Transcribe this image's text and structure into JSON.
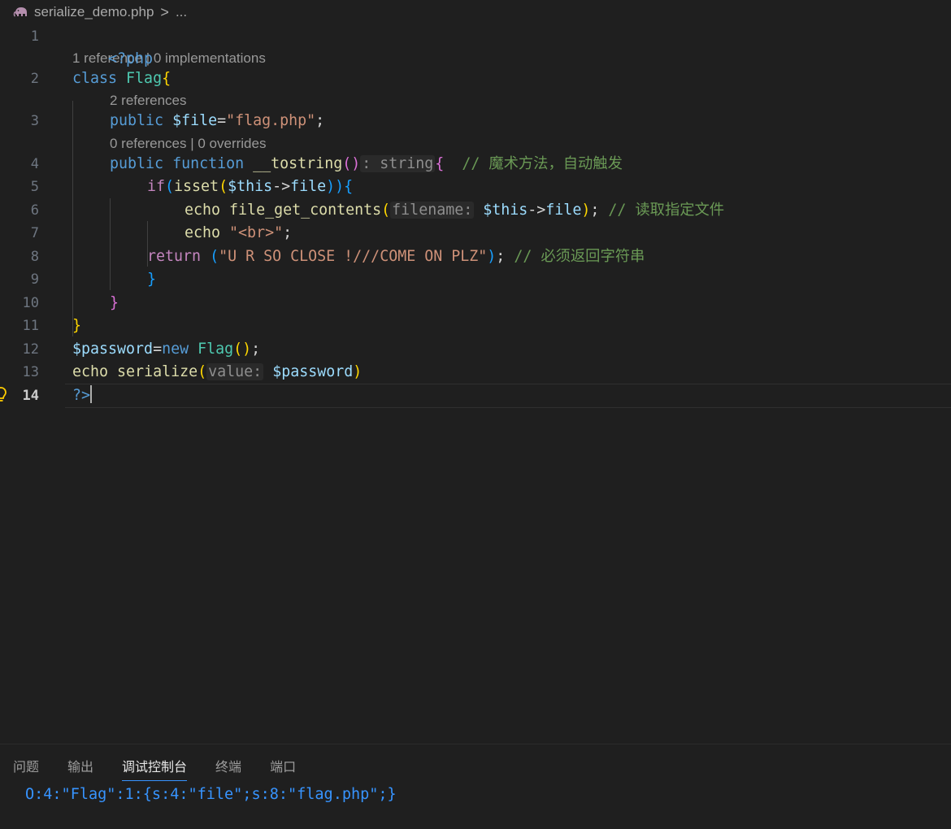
{
  "breadcrumb": {
    "file": "serialize_demo.php",
    "separator": ">",
    "more": "..."
  },
  "editor": {
    "line_numbers": [
      "1",
      "2",
      "3",
      "4",
      "5",
      "6",
      "7",
      "8",
      "9",
      "10",
      "11",
      "12",
      "13",
      "14"
    ],
    "codelens": {
      "l1": "1 reference | 0 implementations",
      "l2": "2 references",
      "l3": "0 references | 0 overrides"
    },
    "code": {
      "l1_open": "<?php",
      "l2_class": "class",
      "l2_name": "Flag",
      "l2_brace": "{",
      "l3_public": "public",
      "l3_var": "$file",
      "l3_eq": "=",
      "l3_str": "\"flag.php\"",
      "l3_semi": ";",
      "l4_public": "public",
      "l4_function": "function",
      "l4_fn": "__tostring",
      "l4_parens": "()",
      "l4_hint": ": string",
      "l4_brace": "{",
      "l4_comment": "// 魔术方法，自动触发",
      "l5_if": "if",
      "l5_p1": "(",
      "l5_isset": "isset",
      "l5_p2": "(",
      "l5_this": "$this",
      "l5_arrow": "->",
      "l5_prop": "file",
      "l5_close": "))",
      "l5_brace": "{",
      "l6_echo": "echo",
      "l6_fn": "file_get_contents",
      "l6_p1": "(",
      "l6_hint": "filename:",
      "l6_this": "$this",
      "l6_arrow": "->",
      "l6_prop": "file",
      "l6_p2": ")",
      "l6_semi": ";",
      "l6_comment": "// 读取指定文件",
      "l7_echo": "echo",
      "l7_str": "\"<br>\"",
      "l7_semi": ";",
      "l8_return": "return",
      "l8_p1": "(",
      "l8_str": "\"U R SO CLOSE !///COME ON PLZ\"",
      "l8_p2": ")",
      "l8_semi": ";",
      "l8_comment": "// 必须返回字符串",
      "l9_brace": "}",
      "l10_brace": "}",
      "l11_brace": "}",
      "l12_var": "$password",
      "l12_eq": "=",
      "l12_new": "new",
      "l12_cls": "Flag",
      "l12_parens": "()",
      "l12_semi": ";",
      "l13_echo": "echo",
      "l13_fn": "serialize",
      "l13_p1": "(",
      "l13_hint": "value:",
      "l13_var": "$password",
      "l13_p2": ")",
      "l14_close": "?>"
    }
  },
  "panel": {
    "tabs": [
      "问题",
      "输出",
      "调试控制台",
      "终端",
      "端口"
    ],
    "active_tab": "调试控制台",
    "output": "O:4:\"Flag\":1:{s:4:\"file\";s:8:\"flag.php\";}"
  },
  "colors": {
    "background": "#1f1f1f",
    "keyword": "#569cd6",
    "control": "#c586c0",
    "class": "#4ec9b0",
    "variable": "#9cdcfe",
    "string": "#ce9178",
    "function": "#dcdcaa",
    "comment": "#6a9955",
    "accent": "#3794ff"
  },
  "icons": {
    "file_type": "php-elephant-icon",
    "lightbulb": "lightbulb-icon"
  }
}
